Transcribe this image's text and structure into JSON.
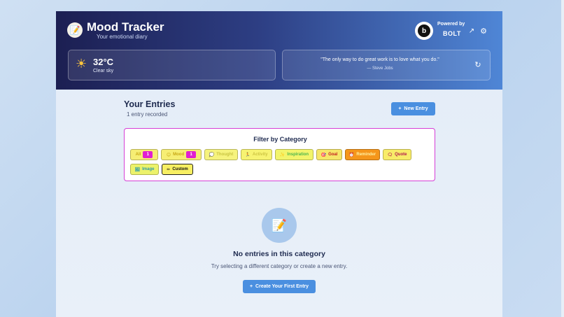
{
  "header": {
    "title": "Mood Tracker",
    "subtitle": "Your emotional diary",
    "logo_icon": "📝",
    "powered_by_label": "Powered by",
    "powered_by_brand": "BOLT",
    "bolt_letter": "b",
    "external_link_icon": "↗",
    "settings_icon": "⚙"
  },
  "weather": {
    "icon": "☀",
    "temperature": "32°C",
    "condition": "Clear sky"
  },
  "quote": {
    "text": "\"The only way to do great work is to love what you do.\"",
    "author": "— Steve Jobs",
    "refresh_icon": "↻"
  },
  "entries": {
    "title": "Your Entries",
    "count_text": "1 entry recorded",
    "new_entry_label": "New Entry",
    "new_entry_icon": "+"
  },
  "filter": {
    "title": "Filter by Category",
    "chips": [
      {
        "label": "All",
        "icon": "",
        "count": "1",
        "bg": "#f6ee74",
        "color": "#c8a815"
      },
      {
        "label": "Mood",
        "icon": "😊",
        "count": "1",
        "bg": "#f6ee74",
        "color": "#c8a815"
      },
      {
        "label": "Thought",
        "icon": "💭",
        "count": "",
        "bg": "#f6f37d",
        "color": "#c9c441"
      },
      {
        "label": "Activity",
        "icon": "🏃",
        "count": "",
        "bg": "#f7f372",
        "color": "#cdc442"
      },
      {
        "label": "Inspiration",
        "icon": "✨",
        "count": "",
        "bg": "#f2f46b",
        "color": "#4bb54e"
      },
      {
        "label": "Goal",
        "icon": "🎯",
        "count": "",
        "bg": "#f6e66a",
        "color": "#c22020"
      },
      {
        "label": "Reminder",
        "icon": "⏰",
        "count": "",
        "bg": "#f5961b",
        "color": "#fff2a6"
      },
      {
        "label": "Quote",
        "icon": "🗨",
        "count": "",
        "bg": "#f8ec69",
        "color": "#b1174d"
      },
      {
        "label": "Image",
        "icon": "🖼",
        "count": "",
        "bg": "#ecf26a",
        "color": "#2f9ca9"
      },
      {
        "label": "Custom",
        "icon": "✏",
        "count": "",
        "bg": "#f7ef62",
        "color": "#111111"
      }
    ]
  },
  "empty_state": {
    "icon": "📝",
    "title": "No entries in this category",
    "subtitle": "Try selecting a different category or create a new entry.",
    "button_label": "Create Your First Entry",
    "button_icon": "+"
  }
}
